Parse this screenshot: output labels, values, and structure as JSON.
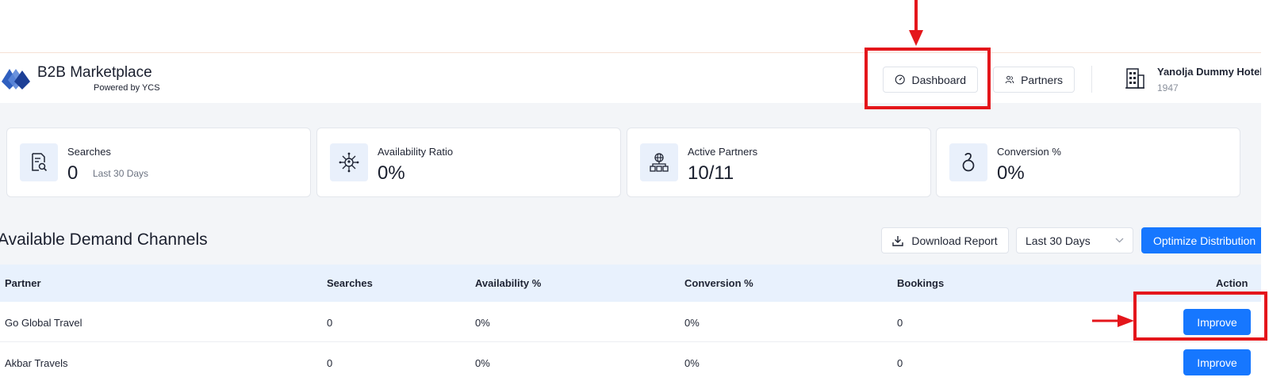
{
  "header": {
    "brand_name": "B2B Marketplace",
    "brand_sub": "Powered by YCS",
    "nav": {
      "dashboard": "Dashboard",
      "partners": "Partners"
    },
    "hotel": {
      "name": "Yanolja Dummy Hotel",
      "id": "1947"
    }
  },
  "stats": [
    {
      "label": "Searches",
      "value": "0",
      "sub": "Last 30 Days",
      "icon": "search-report-icon"
    },
    {
      "label": "Availability Ratio",
      "value": "0%",
      "icon": "availability-network-icon"
    },
    {
      "label": "Active Partners",
      "value": "10/11",
      "icon": "partners-globe-icon"
    },
    {
      "label": "Conversion %",
      "value": "0%",
      "icon": "conversion-icon"
    }
  ],
  "section": {
    "title": "Available Demand Channels",
    "download_label": "Download Report",
    "period_selected": "Last 30 Days",
    "optimize_label": "Optimize Distribution"
  },
  "table": {
    "columns": [
      "Partner",
      "Searches",
      "Availability %",
      "Conversion %",
      "Bookings",
      "Action"
    ],
    "rows": [
      {
        "partner": "Go Global Travel",
        "searches": "0",
        "availability": "0%",
        "conversion": "0%",
        "bookings": "0",
        "action": "Improve"
      },
      {
        "partner": "Akbar Travels",
        "searches": "0",
        "availability": "0%",
        "conversion": "0%",
        "bookings": "0",
        "action": "Improve"
      }
    ]
  },
  "colors": {
    "primary": "#1677ff",
    "annotation": "#e4161b",
    "table_header_bg": "#e8f1fd",
    "band_bg": "#f3f5f8"
  }
}
